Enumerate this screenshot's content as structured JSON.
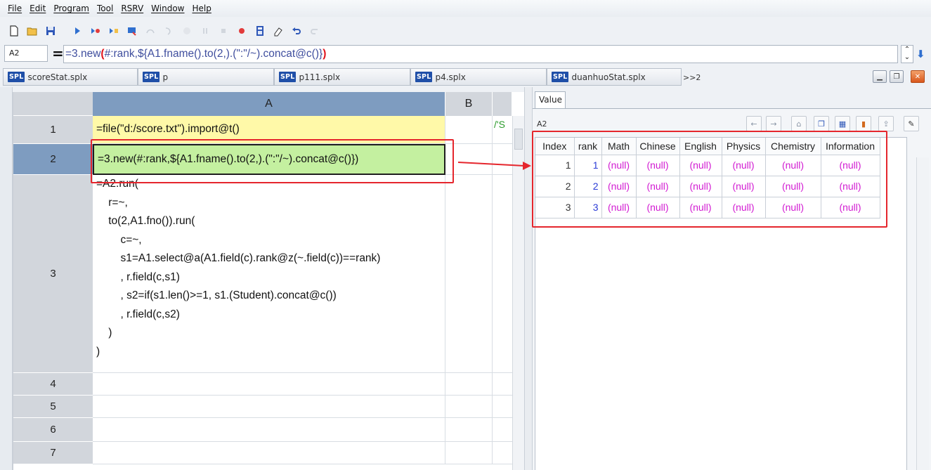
{
  "menu": [
    "File",
    "Edit",
    "Program",
    "Tool",
    "RSRV",
    "Window",
    "Help"
  ],
  "toolbar_icons": [
    "new-file-icon",
    "open-folder-icon",
    "save-icon",
    "run-icon",
    "run-to-cursor-icon",
    "step-icon",
    "debug-icon",
    "step-over-icon",
    "step-into-icon",
    "step-return-icon",
    "pause-icon",
    "stop-icon",
    "breakpoint-icon",
    "calculator-icon",
    "eraser-icon",
    "undo-icon",
    "redo-icon"
  ],
  "formula_bar": {
    "cell_ref": "A2",
    "eq": "=",
    "formula_pre": "=3.new",
    "formula_paren_open": "(",
    "formula_mid": "#:rank,${A1.fname().to(2,).(\":\"/~).concat@c()}",
    "formula_paren_close": ")"
  },
  "tabs": [
    {
      "badge": "SPL",
      "label": "scoreStat.splx"
    },
    {
      "badge": "SPL",
      "label": "p"
    },
    {
      "badge": "SPL",
      "label": "p111.splx"
    },
    {
      "badge": "SPL",
      "label": "p4.splx"
    },
    {
      "badge": "SPL",
      "label": "duanhuoStat.splx"
    }
  ],
  "tab_more": ">>2",
  "grid": {
    "columns": [
      "A",
      "B"
    ],
    "rows": [
      {
        "num": "1",
        "a": "=file(\"d:/score.txt\").import@t()",
        "c": "/'S"
      },
      {
        "num": "2",
        "a": "=3.new(#:rank,${A1.fname().to(2,).(\":\"/~).concat@c()})",
        "c": ""
      },
      {
        "num": "3",
        "a": "=A2.run(\n    r=~,\n    to(2,A1.fno()).run(\n        c=~,\n        s1=A1.select@a(A1.field(c).rank@z(~.field(c))==rank)\n        , r.field(c,s1)\n        , s2=if(s1.len()>=1, s1.(Student).concat@c())\n        , r.field(c,s2)\n    )\n)",
        "c": ""
      },
      {
        "num": "4",
        "a": "",
        "c": ""
      },
      {
        "num": "5",
        "a": "",
        "c": ""
      },
      {
        "num": "6",
        "a": "",
        "c": ""
      },
      {
        "num": "7",
        "a": "",
        "c": ""
      }
    ]
  },
  "value_panel": {
    "tab": "Value",
    "cell_ref": "A2",
    "columns": [
      "Index",
      "rank",
      "Math",
      "Chinese",
      "English",
      "Physics",
      "Chemistry",
      "Information"
    ],
    "rows": [
      {
        "index": "1",
        "rank": "1",
        "values": [
          "(null)",
          "(null)",
          "(null)",
          "(null)",
          "(null)",
          "(null)"
        ]
      },
      {
        "index": "2",
        "rank": "2",
        "values": [
          "(null)",
          "(null)",
          "(null)",
          "(null)",
          "(null)",
          "(null)"
        ]
      },
      {
        "index": "3",
        "rank": "3",
        "values": [
          "(null)",
          "(null)",
          "(null)",
          "(null)",
          "(null)",
          "(null)"
        ]
      }
    ]
  },
  "colors": {
    "selected_header": "#7e9cc0",
    "cell1_bg": "#fff9a8",
    "cell2_bg": "#c4f0a0",
    "annotation": "#e5262d",
    "null_text": "#d21bd2",
    "rank_text": "#2b3bd6"
  }
}
